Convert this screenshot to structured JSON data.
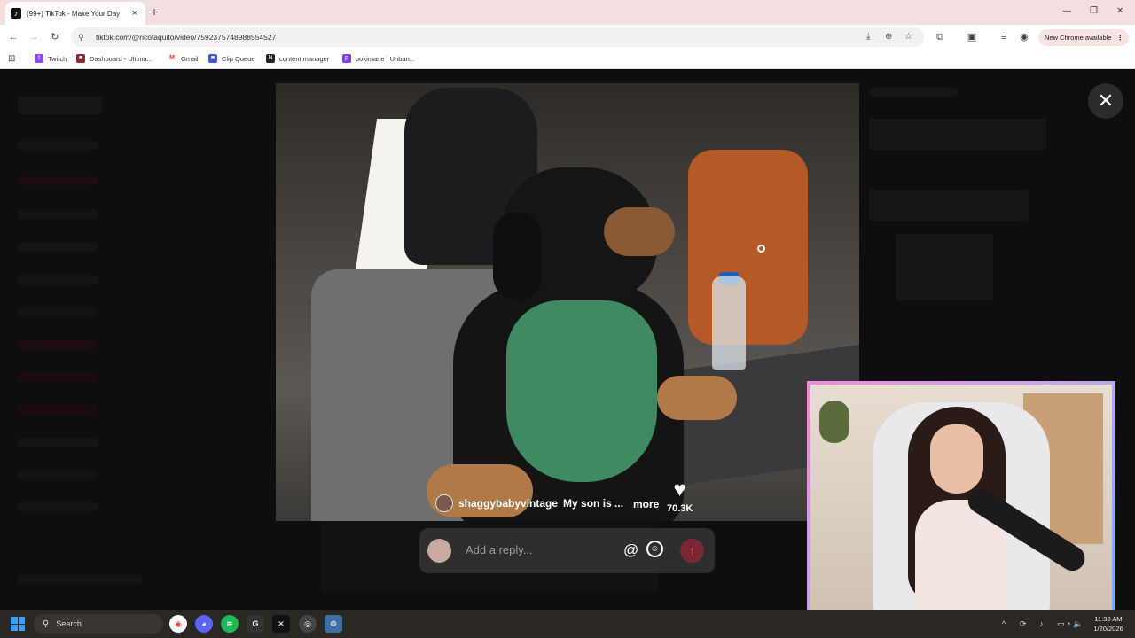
{
  "browser": {
    "tab": {
      "title": "(99+) TikTok - Make Your Day",
      "close_icon": "×"
    },
    "new_tab_icon": "+",
    "window_controls": {
      "minimize": "—",
      "restore": "❐",
      "close": "✕"
    },
    "nav": {
      "back": "←",
      "forward": "→",
      "reload": "↻"
    },
    "url": "tiktok.com/@ricotaquito/video/7592375748988554527",
    "url_info_icon": "⚲",
    "omnibox_icons": [
      "⤓",
      "⊕",
      "☆"
    ],
    "toolbar_icons": [
      "⧉",
      "▣",
      "≡",
      "◉"
    ],
    "chrome_notice": "New Chrome available",
    "chrome_notice_menu": "⋮",
    "apps_icon": "⊞",
    "bookmarks": [
      {
        "label": "Twitch",
        "color": "#9146ff",
        "glyph": "t"
      },
      {
        "label": "Dashboard - Ultima...",
        "color": "#8a2b2b",
        "glyph": "■"
      },
      {
        "label": "Gmail",
        "color": "#d93025",
        "glyph": "M"
      },
      {
        "label": "Clip Queue",
        "color": "#3b5bdb",
        "glyph": "■"
      },
      {
        "label": "content manager",
        "color": "#222222",
        "glyph": "N"
      },
      {
        "label": "pokimane | Unban...",
        "color": "#7b3fe4",
        "glyph": "p"
      }
    ]
  },
  "viewer": {
    "close_icon": "✕",
    "post": {
      "username": "shaggybabyvintage",
      "caption": "My son is ...",
      "more_label": "more",
      "like_icon": "♥",
      "like_count": "70.3K"
    },
    "reply": {
      "placeholder": "Add a reply...",
      "mention_icon": "@",
      "emoji_icon": "☺",
      "send_icon": "↑"
    }
  },
  "taskbar": {
    "search_icon": "⚲",
    "search_label": "Search",
    "apps": [
      {
        "name": "chrome",
        "glyph": "◉",
        "color": "#e8453c"
      },
      {
        "name": "discord",
        "glyph": "◕",
        "color": "#5865f2"
      },
      {
        "name": "spotify",
        "glyph": "≋",
        "color": "#1db954"
      },
      {
        "name": "app-g",
        "glyph": "G",
        "color": "#333333"
      },
      {
        "name": "app-x",
        "glyph": "✕",
        "color": "#111111"
      },
      {
        "name": "obs",
        "glyph": "◎",
        "color": "#444444"
      },
      {
        "name": "settings",
        "glyph": "⚙",
        "color": "#3c6ea8"
      }
    ],
    "tray_icons": [
      "^",
      "⟳",
      "♪",
      "▭",
      "◔",
      "🔈"
    ],
    "time": "11:38 AM",
    "date": "1/20/2026"
  }
}
